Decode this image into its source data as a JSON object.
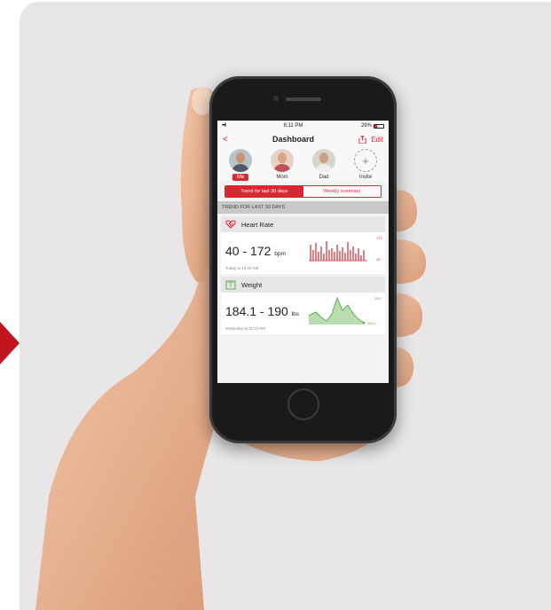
{
  "status_bar": {
    "signal": "•••ll",
    "time": "8:11 PM",
    "battery": "29%"
  },
  "nav": {
    "title": "Dashboard",
    "edit_label": "Edit",
    "back_glyph": "<"
  },
  "people": [
    {
      "name": "Me",
      "selected": true
    },
    {
      "name": "Mom",
      "selected": false
    },
    {
      "name": "Dad",
      "selected": false
    },
    {
      "name": "Invite",
      "selected": false
    }
  ],
  "segments": {
    "left": "Trend for last 30 days",
    "right": "Weekly summary"
  },
  "section_title": "TREND FOR LAST 30 DAYS",
  "metrics": {
    "heart": {
      "label": "Heart Rate",
      "value": "40 - 172",
      "unit": "bpm",
      "time": "Today at 10:20 AM",
      "max_label": "172",
      "min_label": "40",
      "color": "#d62a33"
    },
    "weight": {
      "label": "Weight",
      "value": "184.1 - 190",
      "unit": "lbs",
      "time": "Yesterday at 11:13 PM",
      "max_label": "190",
      "min_label": "184.1",
      "color": "#5cae4e"
    }
  },
  "colors": {
    "accent": "#d62a33",
    "arrow": "#c0141e",
    "background": "#e9e6e8"
  }
}
